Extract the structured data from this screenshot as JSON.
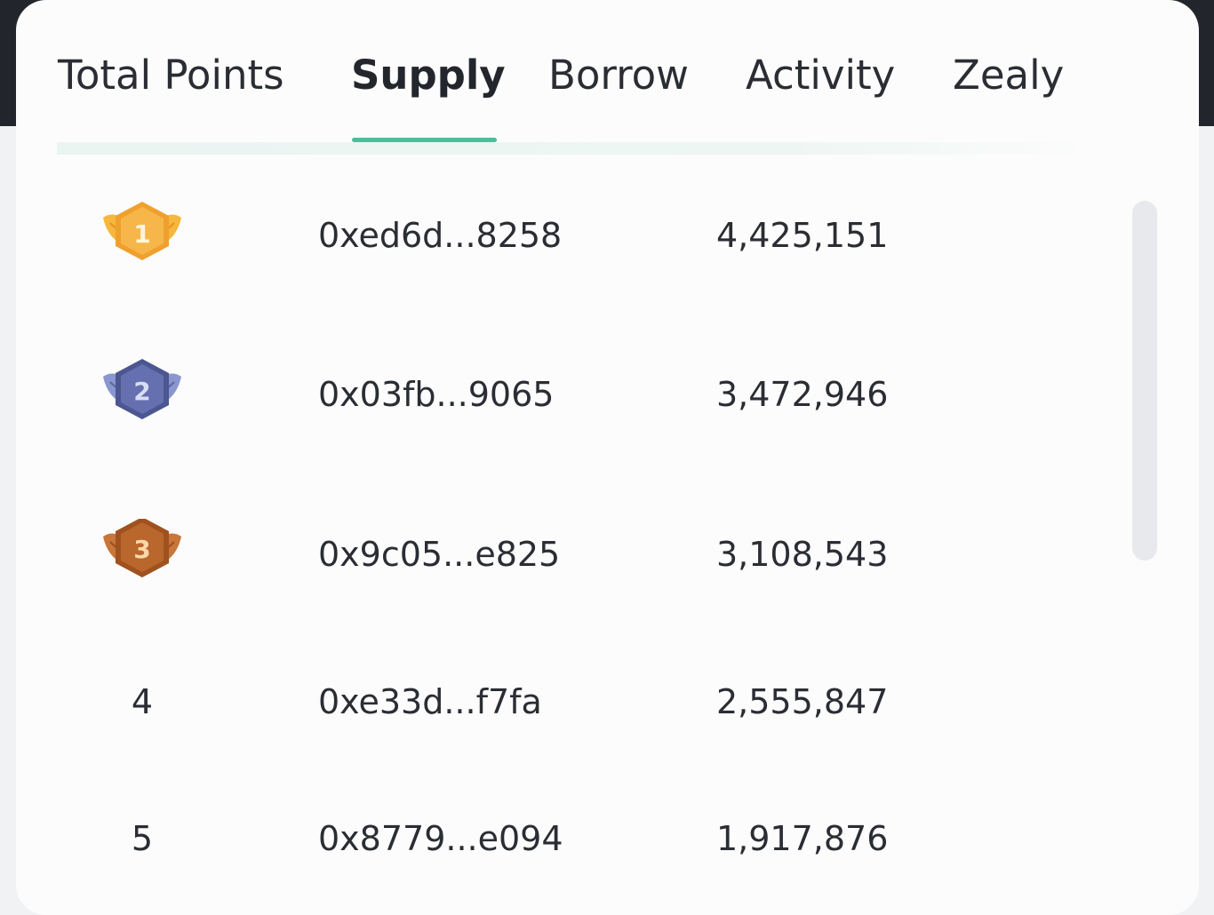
{
  "tabs": [
    {
      "label": "Total Points"
    },
    {
      "label": "Supply"
    },
    {
      "label": "Borrow"
    },
    {
      "label": "Activity"
    },
    {
      "label": "Zealy"
    }
  ],
  "active_tab": "Supply",
  "colors": {
    "accent": "#4bbf9b",
    "gold": "#f4a53a",
    "silver": "#5e6aa8",
    "bronze": "#b8642a"
  },
  "leaderboard": {
    "rows": [
      {
        "rank": "1",
        "badge": "gold-medal-icon",
        "address": "0xed6d...8258",
        "points": "4,425,151"
      },
      {
        "rank": "2",
        "badge": "silver-medal-icon",
        "address": "0x03fb...9065",
        "points": "3,472,946"
      },
      {
        "rank": "3",
        "badge": "bronze-medal-icon",
        "address": "0x9c05...e825",
        "points": "3,108,543"
      },
      {
        "rank": "4",
        "address": "0xe33d...f7fa",
        "points": "2,555,847"
      },
      {
        "rank": "5",
        "address": "0x8779...e094",
        "points": "1,917,876"
      }
    ]
  }
}
